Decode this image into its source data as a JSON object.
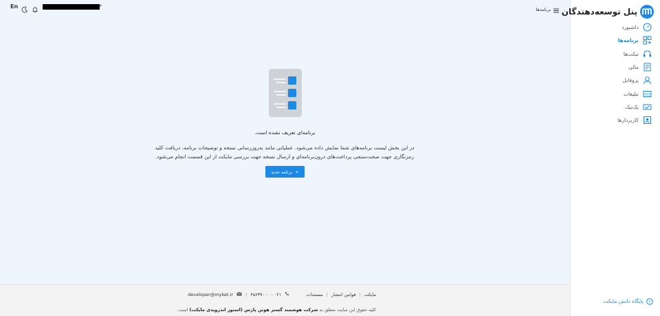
{
  "brand": {
    "title": "پنل توسعه‌دهندگان",
    "logo_letter": "m"
  },
  "colors": {
    "accent": "#1e88e5",
    "background": "#eef5fd",
    "sidebar": "#ffffff"
  },
  "sidebar": {
    "items": [
      {
        "label": "داشبورد",
        "icon": "dashboard-icon",
        "active": false
      },
      {
        "label": "برنامه‌ها",
        "icon": "apps-icon",
        "active": true
      },
      {
        "label": "تیکت‌ها",
        "icon": "headset-icon",
        "active": false
      },
      {
        "label": "مالی",
        "icon": "finance-icon",
        "active": false
      },
      {
        "label": "پروفایل",
        "icon": "profile-icon",
        "active": false
      },
      {
        "label": "تبلیغات",
        "icon": "ads-icon",
        "active": false
      },
      {
        "label": "یک‌تیک",
        "icon": "ticket-icon",
        "active": false
      },
      {
        "label": "کاربردازها",
        "icon": "users-icon",
        "active": false
      }
    ],
    "knowledge_base": "پایگاه دانش مایکت"
  },
  "topbar": {
    "menu_label": "برنامه‌ها",
    "language": "En",
    "username": "",
    "icons": [
      "menu-icon",
      "bell-icon",
      "moon-icon",
      "chevron-down-icon"
    ]
  },
  "empty_state": {
    "title": "برنامه‌ای تعریف نشده است.",
    "description": "در این بخش لیست برنامه‌های شما نمایش داده می‌شود. عملیاتی مانند به‌روزرسانی نسخه و توضیحات برنامه، دریافت کلید رمزنگاری جهت صحت‌سنجی پرداخت‌های درون‌برنامه‌ای و ارسال نسخه جهت بررسی مایکت از این قسمت انجام می‌شود.",
    "button_label": "برنامه جدید",
    "button_icon": "+"
  },
  "footer": {
    "links": [
      "مایکت",
      "قوانین انتشار",
      "مستندات"
    ],
    "phone": "۰۲۱ - ۴۵۶۳۷۰۰۰",
    "email": "developer@myket.ir",
    "copyright_prefix": "کلیه حقوق این سایت متعلق به",
    "copyright_company": "شرکت هوشمند گستر هوتن پارس (استور اندرویدی مایکت)",
    "copyright_suffix": "است."
  }
}
